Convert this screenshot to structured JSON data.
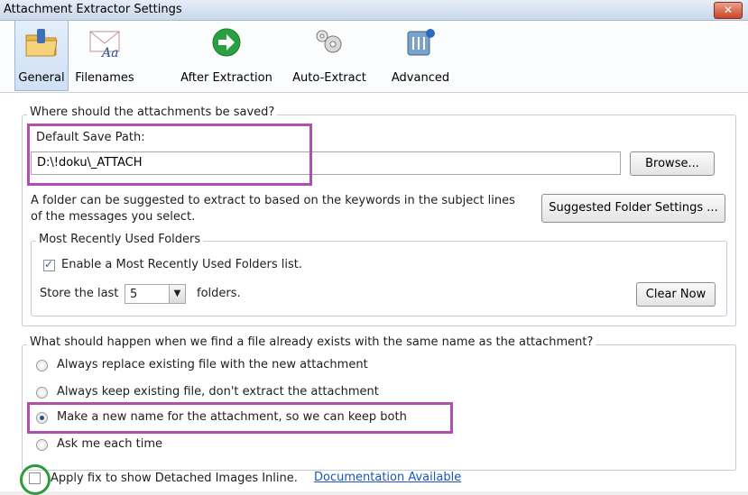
{
  "window": {
    "title": "Attachment Extractor Settings",
    "close_glyph": "✕"
  },
  "tabs": [
    {
      "label": "General",
      "icon": "folder-icon",
      "active": true
    },
    {
      "label": "Filenames",
      "icon": "envelope-icon"
    },
    {
      "label": "After Extraction",
      "icon": "arrow-icon"
    },
    {
      "label": "Auto-Extract",
      "icon": "gears-icon"
    },
    {
      "label": "Advanced",
      "icon": "advanced-icon"
    }
  ],
  "save": {
    "legend": "Where should the attachments be saved?",
    "default_path_label": "Default Save Path:",
    "default_path_value": "D:\\!doku\\_ATTACH",
    "browse_label": "Browse...",
    "suggest_text_line1": "A folder can be suggested to extract to based on the keywords in the subject lines",
    "suggest_text_line2": "of the messages you select.",
    "suggest_button": "Suggested Folder Settings ...",
    "mru": {
      "legend": "Most Recently Used Folders",
      "enable_label": "Enable a Most Recently Used Folders list.",
      "enable_checked": true,
      "store_prefix": "Store the last",
      "store_value": "5",
      "store_suffix": "folders.",
      "clear_button": "Clear Now"
    }
  },
  "existing": {
    "legend": "What should happen when we find a file already exists with the same name as the attachment?",
    "options": [
      {
        "label": "Always replace existing file with the new attachment",
        "checked": false
      },
      {
        "label": "Always keep existing file, don't extract the attachment",
        "checked": false
      },
      {
        "label": "Make a new name for the attachment, so we can keep both",
        "checked": true
      },
      {
        "label": "Ask me each time",
        "checked": false
      }
    ]
  },
  "footer": {
    "fix_label": "Apply fix to show Detached Images Inline.",
    "fix_checked": false,
    "doc_link": "Documentation Available"
  },
  "colors": {
    "highlight_purple": "#b14fb0",
    "highlight_green": "#2d9b3a",
    "link": "#1a55c0"
  }
}
